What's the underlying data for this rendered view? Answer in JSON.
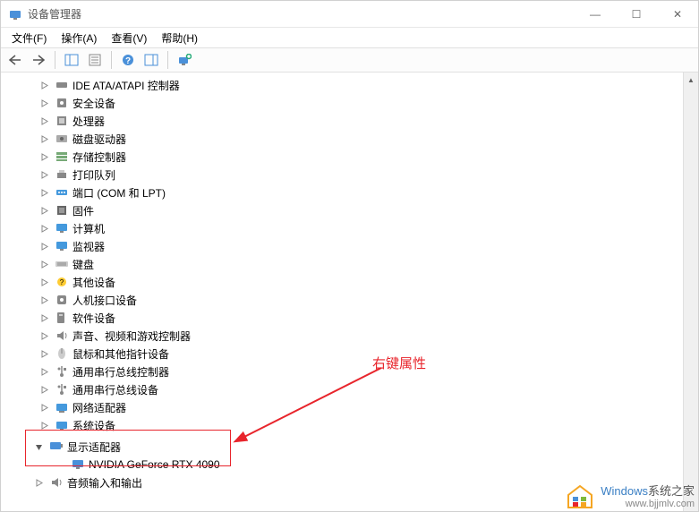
{
  "window": {
    "title": "设备管理器",
    "controls": {
      "min": "—",
      "max": "☐",
      "close": "✕"
    }
  },
  "menus": {
    "file": "文件(F)",
    "action": "操作(A)",
    "view": "查看(V)",
    "help": "帮助(H)"
  },
  "tree": {
    "items": [
      {
        "label": "IDE ATA/ATAPI 控制器",
        "icon": "ide"
      },
      {
        "label": "安全设备",
        "icon": "security"
      },
      {
        "label": "处理器",
        "icon": "cpu"
      },
      {
        "label": "磁盘驱动器",
        "icon": "disk"
      },
      {
        "label": "存储控制器",
        "icon": "storage"
      },
      {
        "label": "打印队列",
        "icon": "printer"
      },
      {
        "label": "端口 (COM 和 LPT)",
        "icon": "port"
      },
      {
        "label": "固件",
        "icon": "firmware"
      },
      {
        "label": "计算机",
        "icon": "computer"
      },
      {
        "label": "监视器",
        "icon": "monitor"
      },
      {
        "label": "键盘",
        "icon": "keyboard"
      },
      {
        "label": "其他设备",
        "icon": "other"
      },
      {
        "label": "人机接口设备",
        "icon": "hid"
      },
      {
        "label": "软件设备",
        "icon": "software"
      },
      {
        "label": "声音、视频和游戏控制器",
        "icon": "sound"
      },
      {
        "label": "鼠标和其他指针设备",
        "icon": "mouse"
      },
      {
        "label": "通用串行总线控制器",
        "icon": "usb"
      },
      {
        "label": "通用串行总线设备",
        "icon": "usb"
      },
      {
        "label": "网络适配器",
        "icon": "network"
      },
      {
        "label": "系统设备",
        "icon": "system"
      }
    ],
    "display_adapter": {
      "label": "显示适配器",
      "child": "NVIDIA GeForce RTX 4090"
    },
    "audio": {
      "label": "音频输入和输出"
    }
  },
  "annotation": {
    "text": "右键属性"
  },
  "watermark": {
    "brand": "Windows",
    "suffix": "系统之家",
    "url": "www.bjjmlv.com"
  }
}
